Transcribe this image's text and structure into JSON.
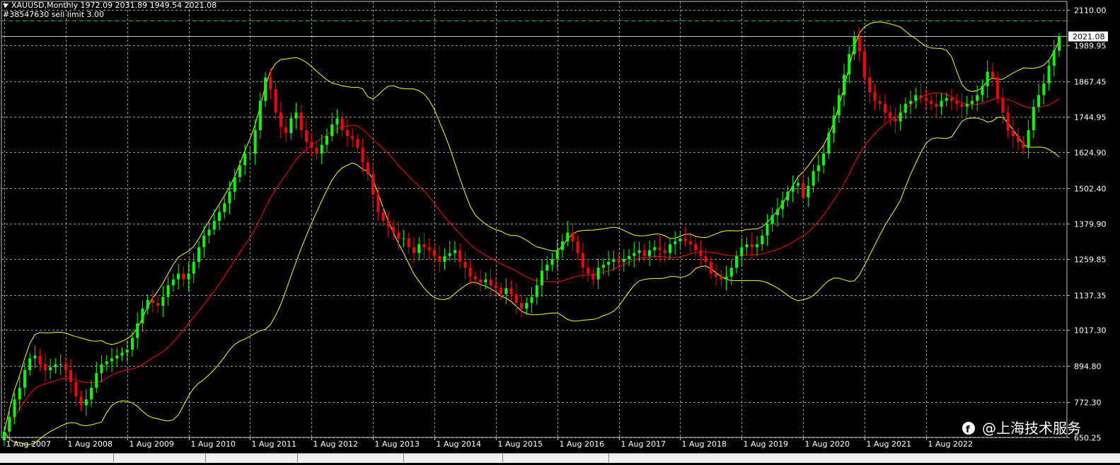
{
  "header": {
    "symbol_line": "XAUUSD,Monthly  1972.09 2031.89 1949.54 2021.08",
    "order_line": "#38547630 sell limit 3.00"
  },
  "watermark": {
    "text": "@上海技术服务"
  },
  "colors": {
    "background": "#000000",
    "bull": "#00ff00",
    "bear": "#ff0000",
    "band": "#ffff00",
    "middle": "#ff0000",
    "grid": "#c0c0c0",
    "order_line": "#00c000"
  },
  "chart_data": {
    "type": "candlestick",
    "symbol": "XAUUSD",
    "timeframe": "Monthly",
    "last": {
      "open": 1972.09,
      "high": 2031.89,
      "low": 1949.54,
      "close": 2021.08
    },
    "current_price_label": "2021.08",
    "sell_limit_order": {
      "id": "#38547630",
      "price": 2075
    },
    "ylim": [
      650.25,
      2140
    ],
    "y_ticks": [
      "2110.00",
      "1989.95",
      "1867.45",
      "1744.95",
      "1624.90",
      "1502.40",
      "1379.90",
      "1259.85",
      "1137.35",
      "1017.30",
      "894.80",
      "772.30",
      "650.25"
    ],
    "x_ticks": [
      "1 Aug 2007",
      "1 Aug 2008",
      "1 Aug 2009",
      "1 Aug 2010",
      "1 Aug 2011",
      "1 Aug 2012",
      "1 Aug 2013",
      "1 Aug 2014",
      "1 Aug 2015",
      "1 Aug 2016",
      "1 Aug 2017",
      "1 Aug 2018",
      "1 Aug 2019",
      "1 Aug 2020",
      "1 Aug 2021",
      "1 Aug 2022"
    ],
    "grid": true,
    "indicators": [
      "Bollinger Bands (yellow)",
      "Moving Average (red)"
    ],
    "closes": [
      670,
      720,
      780,
      820,
      880,
      920,
      930,
      900,
      880,
      890,
      900,
      900,
      880,
      840,
      790,
      760,
      780,
      820,
      870,
      900,
      910,
      920,
      930,
      940,
      950,
      990,
      1040,
      1090,
      1120,
      1110,
      1100,
      1130,
      1170,
      1190,
      1210,
      1190,
      1210,
      1250,
      1300,
      1340,
      1360,
      1390,
      1420,
      1450,
      1490,
      1540,
      1580,
      1620,
      1620,
      1700,
      1800,
      1880,
      1840,
      1760,
      1710,
      1690,
      1740,
      1760,
      1700,
      1660,
      1640,
      1620,
      1650,
      1680,
      1720,
      1740,
      1700,
      1680,
      1670,
      1640,
      1590,
      1550,
      1480,
      1420,
      1390,
      1370,
      1350,
      1330,
      1330,
      1300,
      1280,
      1310,
      1300,
      1290,
      1270,
      1250,
      1270,
      1280,
      1290,
      1250,
      1230,
      1200,
      1190,
      1180,
      1190,
      1170,
      1160,
      1140,
      1160,
      1140,
      1110,
      1090,
      1110,
      1130,
      1170,
      1220,
      1240,
      1260,
      1290,
      1320,
      1350,
      1320,
      1280,
      1230,
      1210,
      1190,
      1230,
      1240,
      1250,
      1260,
      1250,
      1260,
      1270,
      1280,
      1290,
      1270,
      1290,
      1300,
      1290,
      1280,
      1310,
      1320,
      1330,
      1320,
      1310,
      1290,
      1270,
      1250,
      1210,
      1200,
      1190,
      1200,
      1230,
      1270,
      1300,
      1310,
      1300,
      1310,
      1340,
      1380,
      1410,
      1430,
      1460,
      1490,
      1510,
      1520,
      1470,
      1510,
      1560,
      1580,
      1620,
      1690,
      1750,
      1820,
      1890,
      1960,
      2020,
      1970,
      1880,
      1830,
      1800,
      1790,
      1760,
      1740,
      1730,
      1760,
      1790,
      1800,
      1820,
      1810,
      1800,
      1790,
      1780,
      1800,
      1810,
      1800,
      1790,
      1780,
      1790,
      1800,
      1820,
      1850,
      1900,
      1880,
      1810,
      1760,
      1700,
      1680,
      1660,
      1640,
      1700,
      1780,
      1820,
      1860,
      1920,
      1972,
      2021
    ]
  },
  "bottom_tabs": [
    "",
    "",
    "",
    "",
    "",
    ""
  ]
}
